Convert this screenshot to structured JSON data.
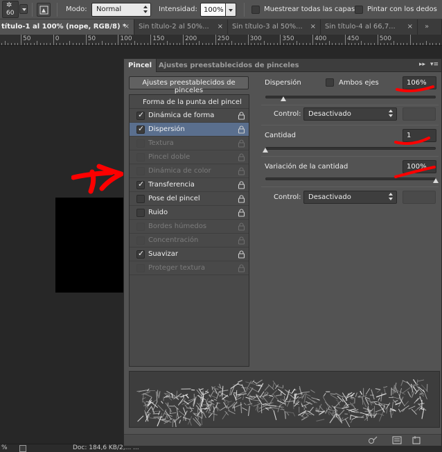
{
  "options_bar": {
    "brush_size": "60",
    "mode_label": "Modo:",
    "mode_value": "Normal",
    "intensity_label": "Intensidad:",
    "intensity_value": "100%",
    "sample_all_layers_label": "Muestrear todas las capas",
    "finger_paint_label": "Pintar con los dedos"
  },
  "document_tabs": [
    {
      "label": "título-1 al 100% (nope, RGB/8) *",
      "active": true
    },
    {
      "label": "Sin título-2 al 50%...",
      "active": false
    },
    {
      "label": "Sin título-3 al 50%...",
      "active": false
    },
    {
      "label": "Sin título-4 al 66,7...",
      "active": false
    }
  ],
  "ruler": {
    "labels": [
      "50",
      "0",
      "50",
      "100",
      "150",
      "200",
      "250",
      "300",
      "350",
      "400",
      "450",
      "500"
    ]
  },
  "status_bar": {
    "zoom": "%",
    "doc_info": "Doc: 184,6 KB/2,... ..."
  },
  "brush_panel": {
    "tabs": [
      "Pincel",
      "Ajustes preestablecidos de pinceles"
    ],
    "presets_button": "Ajustes preestablecidos de pinceles",
    "brush_tip_header": "Forma de la punta del pincel",
    "options": [
      {
        "label": "Dinámica de forma",
        "checked": true,
        "enabled": true,
        "selected": false
      },
      {
        "label": "Dispersión",
        "checked": true,
        "enabled": true,
        "selected": true
      },
      {
        "label": "Textura",
        "checked": false,
        "enabled": false,
        "selected": false
      },
      {
        "label": "Pincel doble",
        "checked": false,
        "enabled": false,
        "selected": false
      },
      {
        "label": "Dinámica de color",
        "checked": false,
        "enabled": false,
        "selected": false
      },
      {
        "label": "Transferencia",
        "checked": true,
        "enabled": true,
        "selected": false
      },
      {
        "label": "Pose del pincel",
        "checked": false,
        "enabled": true,
        "selected": false
      },
      {
        "label": "Ruido",
        "checked": false,
        "enabled": true,
        "selected": false
      },
      {
        "label": "Bordes húmedos",
        "checked": false,
        "enabled": false,
        "selected": false
      },
      {
        "label": "Concentración",
        "checked": false,
        "enabled": false,
        "selected": false
      },
      {
        "label": "Suavizar",
        "checked": true,
        "enabled": true,
        "selected": false
      },
      {
        "label": "Proteger textura",
        "checked": false,
        "enabled": false,
        "selected": false
      }
    ],
    "scatter": {
      "label": "Dispersión",
      "both_axes_label": "Ambos ejes",
      "value": "106%",
      "slider_fraction": 0.106,
      "control_label": "Control:",
      "control_value": "Desactivado"
    },
    "count": {
      "label": "Cantidad",
      "value": "1",
      "slider_fraction": 0.0
    },
    "count_jitter": {
      "label": "Variación de la cantidad",
      "value": "100%",
      "slider_fraction": 1.0,
      "control_label": "Control:",
      "control_value": "Desactivado"
    }
  },
  "colors": {
    "panel_bg": "#535353",
    "selection": "#5a6f8e",
    "annotation_red": "#ff0000"
  }
}
